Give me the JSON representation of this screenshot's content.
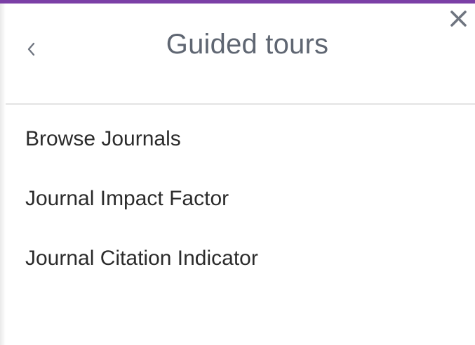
{
  "panel": {
    "title": "Guided tours",
    "accent_color": "#7b3fa6"
  },
  "icons": {
    "back": "chevron-left-icon",
    "close": "close-icon"
  },
  "tours": [
    {
      "label": "Browse Journals"
    },
    {
      "label": "Journal Impact Factor"
    },
    {
      "label": "Journal Citation Indicator"
    }
  ]
}
